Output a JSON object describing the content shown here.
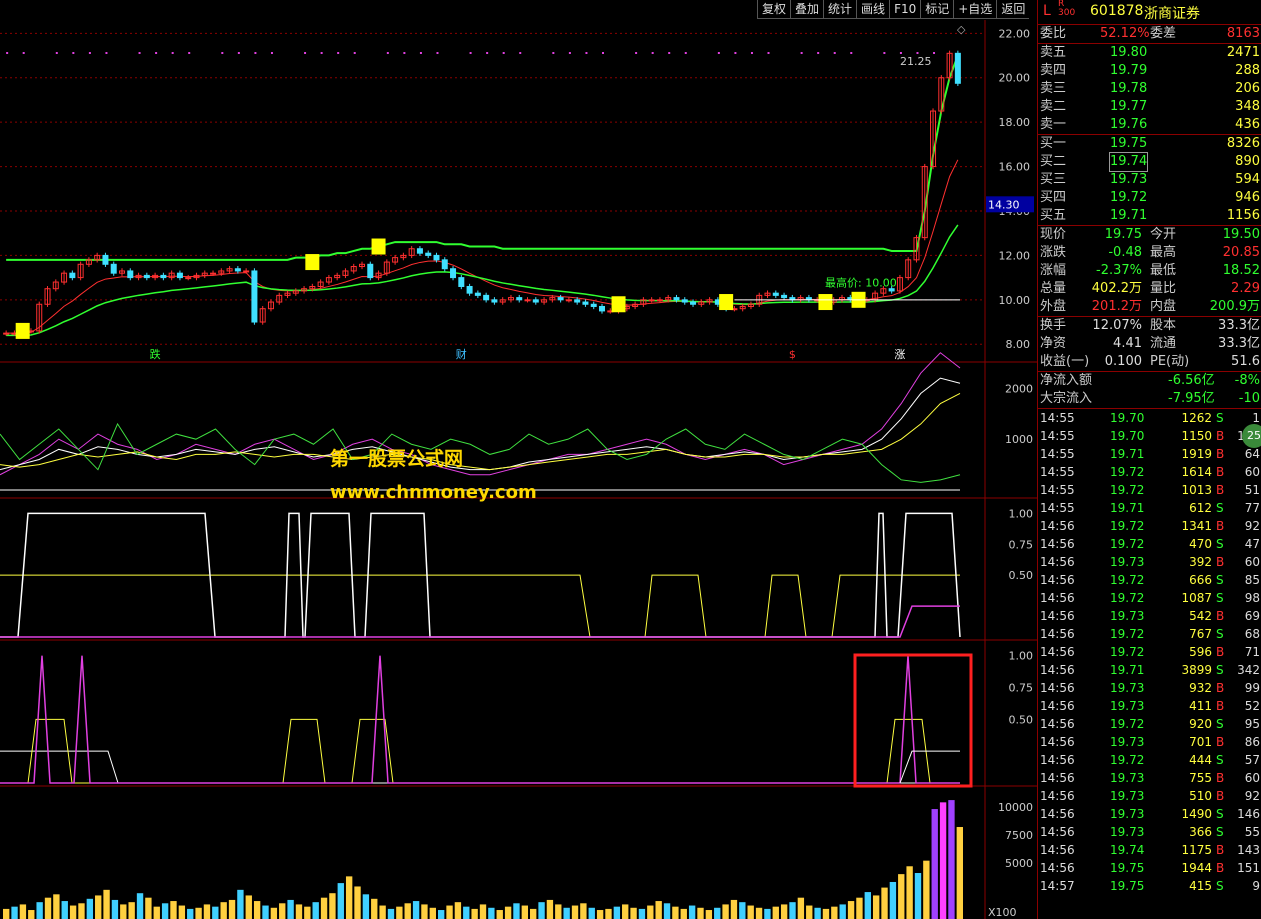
{
  "toolbar": {
    "items": [
      "复权",
      "叠加",
      "统计",
      "画线",
      "F10",
      "标记",
      "+自选",
      "返回"
    ]
  },
  "header": {
    "market_flag": "L",
    "index_tag": "R\n300",
    "code": "601878",
    "name": "浙商证券"
  },
  "quote": {
    "ratio_label": "委比",
    "ratio_value": "52.12%",
    "diff_label": "委差",
    "diff_value": "8163",
    "asks": [
      {
        "label": "卖五",
        "price": "19.80",
        "vol": "2471"
      },
      {
        "label": "卖四",
        "price": "19.79",
        "vol": "288"
      },
      {
        "label": "卖三",
        "price": "19.78",
        "vol": "206"
      },
      {
        "label": "卖二",
        "price": "19.77",
        "vol": "348"
      },
      {
        "label": "卖一",
        "price": "19.76",
        "vol": "436"
      }
    ],
    "bids": [
      {
        "label": "买一",
        "price": "19.75",
        "vol": "8326"
      },
      {
        "label": "买二",
        "price": "19.74",
        "vol": "890"
      },
      {
        "label": "买三",
        "price": "19.73",
        "vol": "594"
      },
      {
        "label": "买四",
        "price": "19.72",
        "vol": "946"
      },
      {
        "label": "买五",
        "price": "19.71",
        "vol": "1156"
      }
    ],
    "stats": [
      {
        "l1": "现价",
        "v1": "19.75",
        "l2": "今开",
        "v2": "19.50"
      },
      {
        "l1": "涨跌",
        "v1": "-0.48",
        "l2": "最高",
        "v2": "20.85"
      },
      {
        "l1": "涨幅",
        "v1": "-2.37%",
        "l2": "最低",
        "v2": "18.52"
      },
      {
        "l1": "总量",
        "v1": "402.2万",
        "l2": "量比",
        "v2": "2.29"
      },
      {
        "l1": "外盘",
        "v1": "201.2万",
        "l2": "内盘",
        "v2": "200.9万"
      }
    ],
    "stats2": [
      {
        "l1": "换手",
        "v1": "12.07%",
        "l2": "股本",
        "v2": "33.3亿"
      },
      {
        "l1": "净资",
        "v1": "4.41",
        "l2": "流通",
        "v2": "33.3亿"
      },
      {
        "l1": "收益(一)",
        "v1": "0.100",
        "l2": "PE(动)",
        "v2": "51.6"
      }
    ],
    "flow": [
      {
        "label": "净流入额",
        "value": "-6.56亿",
        "pct": "-8%"
      },
      {
        "label": "大宗流入",
        "value": "-7.95亿",
        "pct": "-10"
      }
    ],
    "badge": "25"
  },
  "ticks": [
    {
      "t": "14:55",
      "p": "19.70",
      "v": "1262",
      "d": "S",
      "n": "1"
    },
    {
      "t": "14:55",
      "p": "19.70",
      "v": "1150",
      "d": "B",
      "n": "109"
    },
    {
      "t": "14:55",
      "p": "19.71",
      "v": "1919",
      "d": "B",
      "n": "64"
    },
    {
      "t": "14:55",
      "p": "19.72",
      "v": "1614",
      "d": "B",
      "n": "60"
    },
    {
      "t": "14:55",
      "p": "19.72",
      "v": "1013",
      "d": "B",
      "n": "51"
    },
    {
      "t": "14:55",
      "p": "19.71",
      "v": "612",
      "d": "S",
      "n": "77"
    },
    {
      "t": "14:56",
      "p": "19.72",
      "v": "1341",
      "d": "B",
      "n": "92"
    },
    {
      "t": "14:56",
      "p": "19.72",
      "v": "470",
      "d": "S",
      "n": "47"
    },
    {
      "t": "14:56",
      "p": "19.73",
      "v": "392",
      "d": "B",
      "n": "60"
    },
    {
      "t": "14:56",
      "p": "19.72",
      "v": "666",
      "d": "S",
      "n": "85"
    },
    {
      "t": "14:56",
      "p": "19.72",
      "v": "1087",
      "d": "S",
      "n": "98"
    },
    {
      "t": "14:56",
      "p": "19.73",
      "v": "542",
      "d": "B",
      "n": "69"
    },
    {
      "t": "14:56",
      "p": "19.72",
      "v": "767",
      "d": "S",
      "n": "68"
    },
    {
      "t": "14:56",
      "p": "19.72",
      "v": "596",
      "d": "B",
      "n": "71"
    },
    {
      "t": "14:56",
      "p": "19.71",
      "v": "3899",
      "d": "S",
      "n": "342"
    },
    {
      "t": "14:56",
      "p": "19.73",
      "v": "932",
      "d": "B",
      "n": "99"
    },
    {
      "t": "14:56",
      "p": "19.73",
      "v": "411",
      "d": "B",
      "n": "52"
    },
    {
      "t": "14:56",
      "p": "19.72",
      "v": "920",
      "d": "S",
      "n": "95"
    },
    {
      "t": "14:56",
      "p": "19.73",
      "v": "701",
      "d": "B",
      "n": "86"
    },
    {
      "t": "14:56",
      "p": "19.72",
      "v": "444",
      "d": "S",
      "n": "57"
    },
    {
      "t": "14:56",
      "p": "19.73",
      "v": "755",
      "d": "B",
      "n": "60"
    },
    {
      "t": "14:56",
      "p": "19.73",
      "v": "510",
      "d": "B",
      "n": "92"
    },
    {
      "t": "14:56",
      "p": "19.73",
      "v": "1490",
      "d": "S",
      "n": "146"
    },
    {
      "t": "14:56",
      "p": "19.73",
      "v": "366",
      "d": "S",
      "n": "55"
    },
    {
      "t": "14:56",
      "p": "19.74",
      "v": "1175",
      "d": "B",
      "n": "143"
    },
    {
      "t": "14:56",
      "p": "19.75",
      "v": "1944",
      "d": "B",
      "n": "151"
    },
    {
      "t": "14:57",
      "p": "19.75",
      "v": "415",
      "d": "S",
      "n": "9"
    }
  ],
  "watermark": {
    "line1": "第一股票公式网",
    "line2": "www.chnmoney.com"
  },
  "colors": {
    "up": "#ff3030",
    "down": "#40e0ff",
    "green": "#30ff30",
    "yellow": "#ffff40",
    "magenta": "#e040e0",
    "white": "#ffffff",
    "grid": "#8b0000"
  },
  "chart_data": [
    {
      "type": "candlestick",
      "title": "",
      "ylim": [
        7.2,
        22.6
      ],
      "yticks": [
        "8.00",
        "10.00",
        "12.00",
        "14.00",
        "16.00",
        "18.00",
        "20.00",
        "22.00"
      ],
      "ytick_values": [
        8,
        10,
        12,
        14,
        16,
        18,
        20,
        22
      ],
      "current_price_tag": "14.30",
      "high_label": "21.25",
      "annotation": "最高价: 10.00",
      "event_labels": [
        "跌",
        "财",
        "$",
        "涨"
      ],
      "closes": [
        8.5,
        8.5,
        8.6,
        8.6,
        9.8,
        10.5,
        10.8,
        11.2,
        11.0,
        11.6,
        11.8,
        12.0,
        11.6,
        11.2,
        11.3,
        11.0,
        11.1,
        11.0,
        11.1,
        11.0,
        11.2,
        11.0,
        11.0,
        11.1,
        11.2,
        11.2,
        11.3,
        11.4,
        11.3,
        11.3,
        9.0,
        9.6,
        9.9,
        10.2,
        10.3,
        10.4,
        10.5,
        10.6,
        10.8,
        11.0,
        11.1,
        11.3,
        11.5,
        11.6,
        11.0,
        11.2,
        11.7,
        11.9,
        12.0,
        12.3,
        12.1,
        12.0,
        11.8,
        11.4,
        11.0,
        10.6,
        10.3,
        10.2,
        10.0,
        9.9,
        10.0,
        10.1,
        10.0,
        10.0,
        9.9,
        10.0,
        10.1,
        10.0,
        10.0,
        9.9,
        9.8,
        9.7,
        9.5,
        9.5,
        9.6,
        9.7,
        9.8,
        10.0,
        10.0,
        10.0,
        10.1,
        10.0,
        9.9,
        9.8,
        9.9,
        10.0,
        9.8,
        9.6,
        9.6,
        9.7,
        9.8,
        10.2,
        10.3,
        10.2,
        10.1,
        10.0,
        10.1,
        10.0,
        10.0,
        9.9,
        10.0,
        10.1,
        10.0,
        10.0,
        10.0,
        10.3,
        10.5,
        10.4,
        11.0,
        11.8,
        12.8,
        16.0,
        18.5,
        20.0,
        21.1,
        19.75
      ],
      "ma_slow": [
        11.8,
        11.8,
        11.8,
        11.8,
        11.8,
        11.8,
        11.8,
        11.8,
        11.8,
        11.8,
        11.8,
        11.8,
        11.8,
        11.8,
        11.8,
        11.8,
        11.8,
        11.8,
        11.8,
        11.8,
        11.8,
        11.8,
        11.8,
        11.8,
        11.8,
        11.8,
        11.8,
        11.8,
        11.8,
        11.8,
        11.8,
        11.8,
        11.8,
        11.8,
        11.8,
        11.9,
        11.9,
        11.9,
        12.0,
        12.0,
        12.1,
        12.1,
        12.2,
        12.3,
        12.3,
        12.4,
        12.5,
        12.6,
        12.6,
        12.6,
        12.6,
        12.6,
        12.6,
        12.5,
        12.5,
        12.5,
        12.4,
        12.4,
        12.4,
        12.4,
        12.3,
        12.3,
        12.3,
        12.3,
        12.3,
        12.3,
        12.3,
        12.3,
        12.3,
        12.3,
        12.3,
        12.3,
        12.3,
        12.3,
        12.3,
        12.3,
        12.3,
        12.3,
        12.3,
        12.3,
        12.3,
        12.3,
        12.3,
        12.3,
        12.3,
        12.3,
        12.3,
        12.3,
        12.3,
        12.3,
        12.3,
        12.3,
        12.3,
        12.3,
        12.3,
        12.3,
        12.3,
        12.3,
        12.3,
        12.3,
        12.3,
        12.3,
        12.3,
        12.3,
        12.3,
        12.3,
        12.3,
        12.2,
        12.2,
        12.2,
        12.2,
        14.0,
        16.5,
        18.5,
        20.0,
        21.0
      ]
    },
    {
      "type": "line",
      "ylim": [
        0,
        2400
      ],
      "yticks": [
        "1000",
        "2000"
      ],
      "ytick_values": [
        1000,
        2000
      ],
      "series": [
        {
          "values": [
            300,
            500,
            700,
            1000,
            800,
            1100,
            900,
            800,
            600,
            700,
            900,
            800,
            700,
            900,
            1000,
            800,
            600,
            700,
            900,
            1000,
            800,
            700,
            500,
            400,
            300,
            300,
            400,
            500,
            600,
            700,
            700,
            800,
            900,
            1000,
            900,
            700,
            600,
            700,
            800,
            700,
            500,
            600,
            700,
            800,
            900,
            1200,
            1700,
            2300,
            2700,
            2400
          ]
        },
        {
          "values": [
            400,
            500,
            600,
            800,
            700,
            850,
            800,
            700,
            650,
            700,
            800,
            750,
            700,
            800,
            850,
            750,
            650,
            700,
            800,
            850,
            750,
            650,
            550,
            450,
            400,
            400,
            450,
            550,
            600,
            650,
            700,
            750,
            800,
            850,
            800,
            700,
            650,
            700,
            750,
            700,
            600,
            650,
            700,
            750,
            800,
            1000,
            1400,
            1900,
            2200,
            2100
          ]
        },
        {
          "values": [
            500,
            450,
            500,
            600,
            700,
            650,
            700,
            750,
            650,
            600,
            700,
            700,
            750,
            700,
            650,
            700,
            700,
            650,
            600,
            650,
            700,
            650,
            600,
            500,
            450,
            400,
            450,
            500,
            550,
            600,
            650,
            700,
            700,
            750,
            800,
            700,
            650,
            650,
            700,
            700,
            650,
            650,
            700,
            700,
            750,
            800,
            1000,
            1300,
            1700,
            1900
          ]
        },
        {
          "values": [
            1100,
            600,
            900,
            1200,
            800,
            400,
            1300,
            700,
            900,
            1100,
            1000,
            1200,
            800,
            500,
            1000,
            1100,
            900,
            1200,
            600,
            700,
            1100,
            900,
            800,
            1000,
            900,
            700,
            800,
            1100,
            900,
            1000,
            1200,
            800,
            600,
            700,
            1000,
            1200,
            900,
            800,
            1100,
            900,
            700,
            600,
            800,
            1000,
            900,
            500,
            200,
            150,
            200,
            300
          ]
        }
      ]
    },
    {
      "type": "step",
      "ylim": [
        0,
        1.1
      ],
      "yticks": [
        "0.50",
        "0.75",
        "1.00"
      ],
      "ytick_values": [
        0.5,
        0.75,
        1.0
      ]
    },
    {
      "type": "step",
      "ylim": [
        0,
        1.1
      ],
      "yticks": [
        "0.50",
        "0.75",
        "1.00"
      ],
      "ytick_values": [
        0.5,
        0.75,
        1.0
      ]
    },
    {
      "type": "bar",
      "ylim": [
        0,
        11500
      ],
      "yticks": [
        "5000",
        "7500",
        "10000"
      ],
      "ytick_values": [
        5000,
        7500,
        10000
      ],
      "unit": "X100",
      "volumes": [
        900,
        1100,
        1300,
        800,
        1500,
        1900,
        2200,
        1600,
        1200,
        1400,
        1800,
        2100,
        2600,
        1700,
        1300,
        1500,
        2300,
        1900,
        1100,
        1400,
        1600,
        1200,
        900,
        1000,
        1300,
        1100,
        1500,
        1700,
        2600,
        2100,
        1600,
        1200,
        1000,
        1400,
        1700,
        1300,
        1100,
        1500,
        1900,
        2300,
        3200,
        3800,
        2900,
        2200,
        1800,
        1200,
        900,
        1100,
        1400,
        1600,
        1300,
        1000,
        800,
        1200,
        1500,
        1100,
        900,
        1300,
        1000,
        800,
        1100,
        1400,
        1200,
        900,
        1500,
        1700,
        1300,
        1000,
        1200,
        1400,
        1000,
        800,
        900,
        1100,
        1300,
        1000,
        900,
        1200,
        1600,
        1400,
        1100,
        900,
        1200,
        1000,
        800,
        1000,
        1300,
        1700,
        1500,
        1200,
        1000,
        900,
        1100,
        1300,
        1500,
        1900,
        1200,
        1000,
        900,
        1100,
        1300,
        1600,
        1900,
        2400,
        2100,
        2800,
        3300,
        4000,
        4700,
        4100,
        5200,
        9800,
        10400,
        10600,
        8200
      ]
    }
  ]
}
